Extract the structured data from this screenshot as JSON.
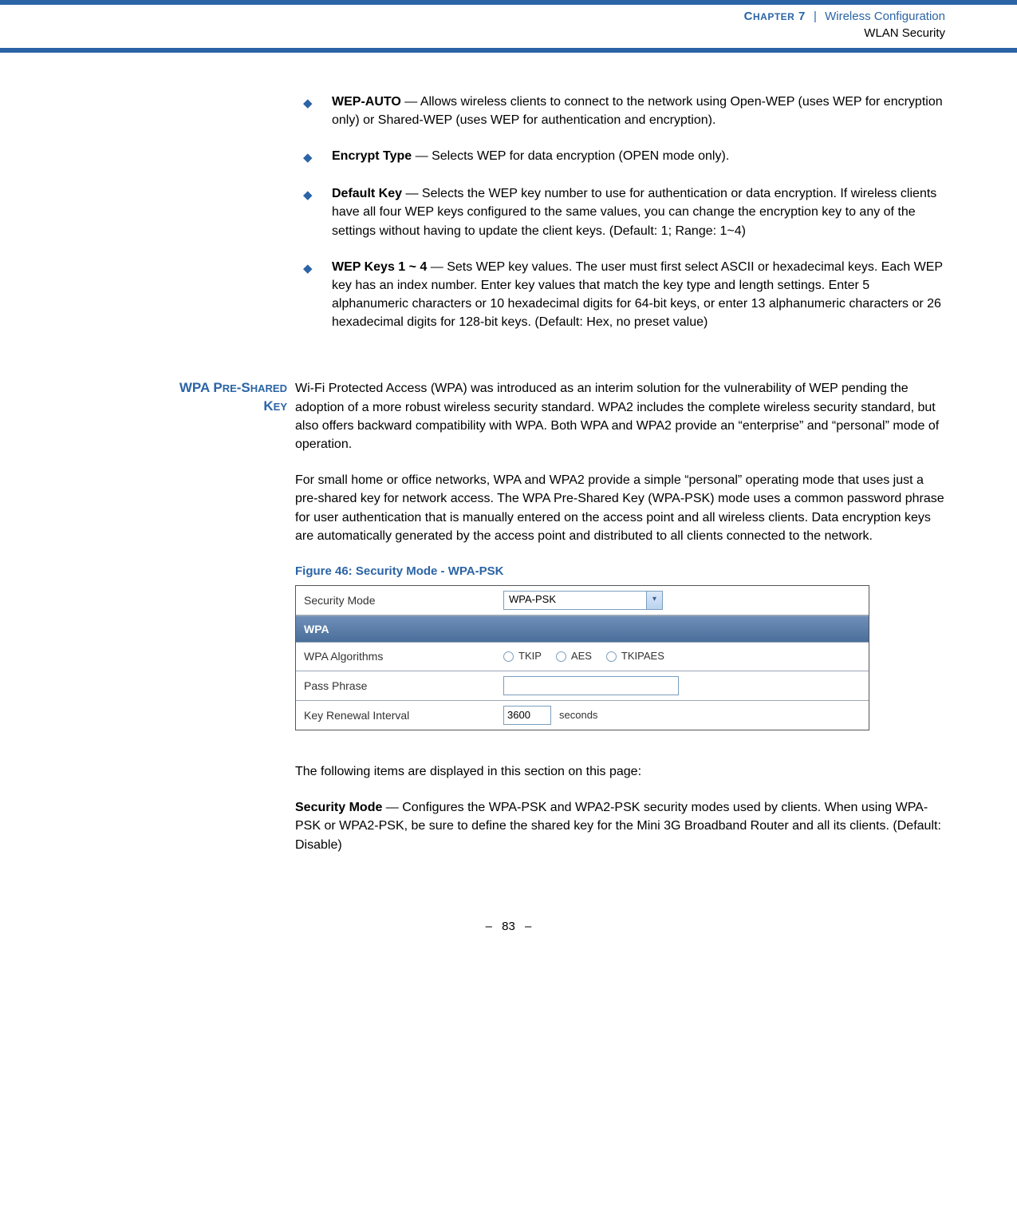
{
  "header": {
    "chapter_small": "C",
    "chapter_word": "HAPTER",
    "chapter_num": " 7",
    "separator": "|",
    "chapter_title": "Wireless Configuration",
    "section_title": "WLAN Security"
  },
  "bullets": [
    {
      "term": "WEP-AUTO",
      "text": " — Allows wireless clients to connect to the network using Open-WEP (uses WEP for encryption only) or Shared-WEP (uses WEP for authentication and encryption)."
    },
    {
      "term": "Encrypt Type",
      "text": " — Selects WEP for data encryption (OPEN mode only)."
    },
    {
      "term": "Default Key",
      "text": " — Selects the WEP key number to use for authentication or data encryption. If wireless clients have all four WEP keys configured to the same values, you can change the encryption key to any of the settings without having to update the client keys. (Default: 1; Range: 1~4)"
    },
    {
      "term": "WEP Keys 1 ~ 4",
      "text": " — Sets WEP key values. The user must first select ASCII or hexadecimal keys. Each WEP key has an index number. Enter key values that match the key type and length settings. Enter 5 alphanumeric characters or 10 hexadecimal digits for 64-bit keys, or enter 13 alphanumeric characters or 26 hexadecimal digits for 128-bit keys. (Default: Hex, no preset value)"
    }
  ],
  "section": {
    "label_line1": "WPA P",
    "label_line1b": "RE",
    "label_line1c": "-S",
    "label_line1d": "HARED",
    "label_line2": "K",
    "label_line2b": "EY",
    "para1": "Wi-Fi Protected Access (WPA) was introduced as an interim solution for the vulnerability of WEP pending the adoption of a more robust wireless security standard. WPA2 includes the complete wireless security standard, but also offers backward compatibility with WPA. Both WPA and WPA2 provide an “enterprise” and “personal” mode of operation.",
    "para2": "For small home or office networks, WPA and WPA2 provide a simple “personal” operating mode that uses just a pre-shared key for network access. The WPA Pre-Shared Key (WPA-PSK) mode uses a common password phrase for user authentication that is manually entered on the access point and all wireless clients. Data encryption keys are automatically generated by the access point and distributed to all clients connected to the network."
  },
  "figure": {
    "caption": "Figure 46:  Security Mode - WPA-PSK",
    "security_mode_label": "Security Mode",
    "security_mode_value": "WPA-PSK",
    "wpa_header": "WPA",
    "row_algorithms_label": "WPA Algorithms",
    "radio_tkip": "TKIP",
    "radio_aes": "AES",
    "radio_tkipaes": "TKIPAES",
    "row_passphrase_label": "Pass Phrase",
    "passphrase_value": "",
    "row_interval_label": "Key Renewal Interval",
    "interval_value": "3600",
    "interval_unit": "seconds"
  },
  "after_figure": {
    "intro": "The following items are displayed in this section on this page:",
    "sm_term": "Security Mode",
    "sm_text": " — Configures the WPA-PSK and WPA2-PSK security modes used by clients. When using WPA-PSK or WPA2-PSK, be sure to define the shared key for the Mini 3G Broadband Router and all its clients. (Default: Disable)"
  },
  "footer": {
    "dash1": "–",
    "page_num": "83",
    "dash2": "–"
  }
}
